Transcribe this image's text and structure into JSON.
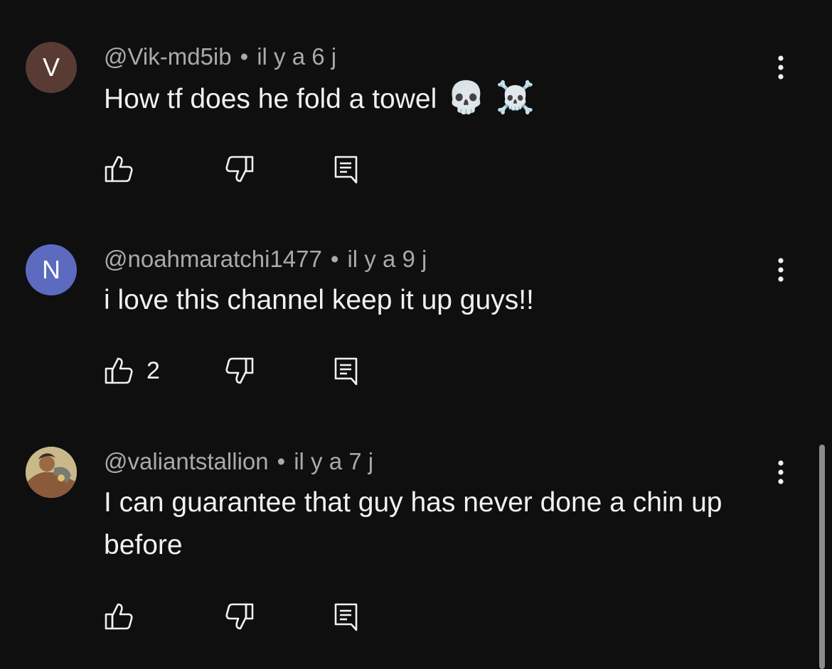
{
  "comments": [
    {
      "avatar_letter": "V",
      "avatar_color": "#5a3b33",
      "author": "@Vik-md5ib",
      "separator": "•",
      "time": "il y a 6 j",
      "text": "How tf does he fold a towel",
      "emojis": [
        "💀",
        "☠️"
      ],
      "likes": ""
    },
    {
      "avatar_letter": "N",
      "avatar_color": "#5c6bc0",
      "author": "@noahmaratchi1477",
      "separator": "•",
      "time": "il y a 9 j",
      "text": "i love this channel keep it up guys!!",
      "emojis": [],
      "likes": "2"
    },
    {
      "avatar_letter": "",
      "avatar_color": "#c9b98a",
      "author": "@valiantstallion",
      "separator": "•",
      "time": "il y a 7 j",
      "text": "I can guarantee that guy has never done a chin up before",
      "emojis": [],
      "likes": ""
    }
  ],
  "icons": {
    "like": "thumbs-up-icon",
    "dislike": "thumbs-down-icon",
    "reply": "reply-comment-icon",
    "more": "more-vertical-icon"
  }
}
